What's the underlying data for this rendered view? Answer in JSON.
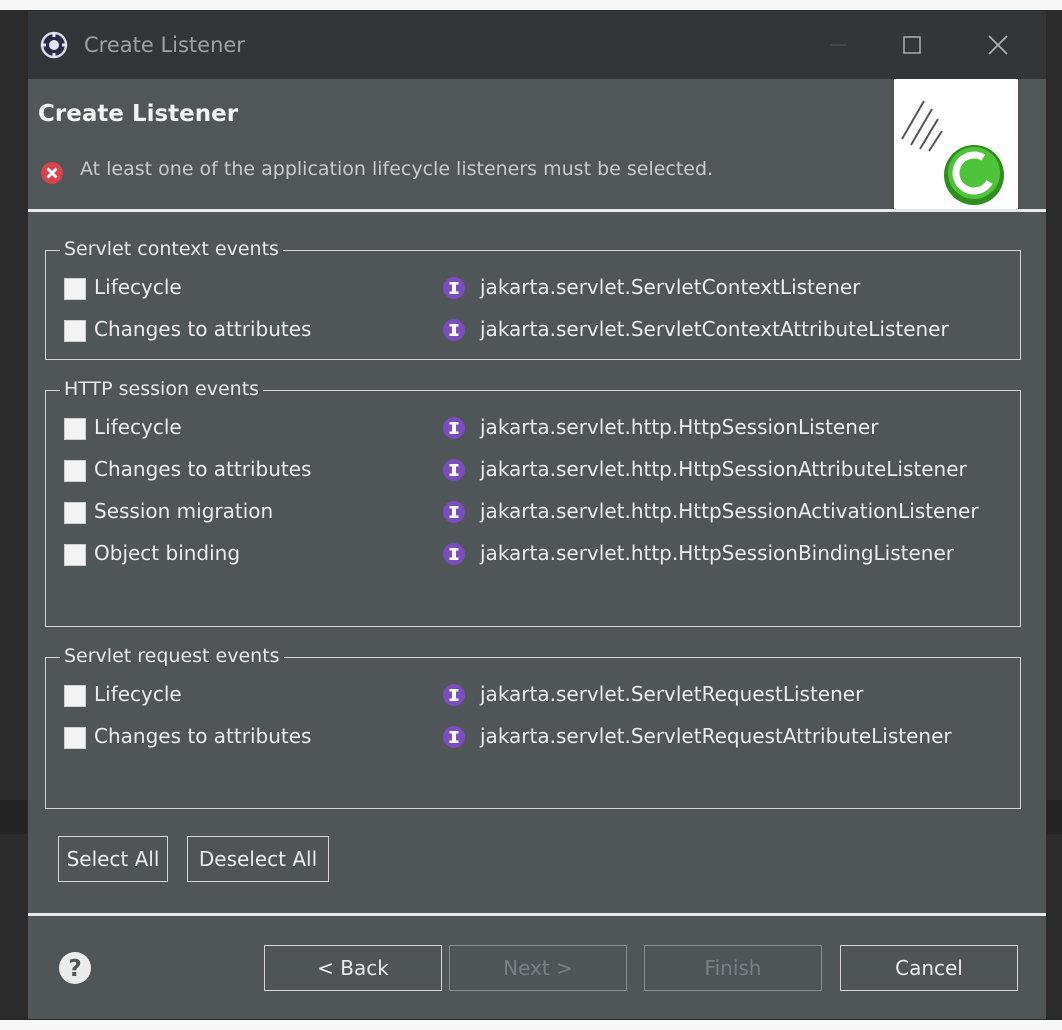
{
  "window": {
    "title": "Create Listener"
  },
  "header": {
    "title": "Create Listener",
    "message": "At least one of the application lifecycle listeners must be selected."
  },
  "groups": [
    {
      "legend": "Servlet context events",
      "items": [
        {
          "label": "Lifecycle",
          "interface": "jakarta.servlet.ServletContextListener",
          "checked": false
        },
        {
          "label": "Changes to attributes",
          "interface": "jakarta.servlet.ServletContextAttributeListener",
          "checked": false
        }
      ]
    },
    {
      "legend": "HTTP session events",
      "items": [
        {
          "label": "Lifecycle",
          "interface": "jakarta.servlet.http.HttpSessionListener",
          "checked": false
        },
        {
          "label": "Changes to attributes",
          "interface": "jakarta.servlet.http.HttpSessionAttributeListener",
          "checked": false
        },
        {
          "label": "Session migration",
          "interface": "jakarta.servlet.http.HttpSessionActivationListener",
          "checked": false
        },
        {
          "label": "Object binding",
          "interface": "jakarta.servlet.http.HttpSessionBindingListener",
          "checked": false
        }
      ]
    },
    {
      "legend": "Servlet request events",
      "items": [
        {
          "label": "Lifecycle",
          "interface": "jakarta.servlet.ServletRequestListener",
          "checked": false
        },
        {
          "label": "Changes to attributes",
          "interface": "jakarta.servlet.ServletRequestAttributeListener",
          "checked": false
        }
      ]
    }
  ],
  "selection_buttons": {
    "select_all": "Select All",
    "deselect_all": "Deselect All"
  },
  "footer": {
    "back": "< Back",
    "next": "Next >",
    "finish": "Finish",
    "cancel": "Cancel"
  },
  "colors": {
    "dialog_bg": "#505558",
    "titlebar_bg": "#333639",
    "interface_icon": "#7c4dbf",
    "error_icon": "#d9434e",
    "class_badge": "#3fae2a"
  },
  "icons": {
    "title": "eclipse-gear-icon",
    "error": "error-x-icon",
    "interface": "interface-i-icon",
    "help": "help-question-icon"
  }
}
